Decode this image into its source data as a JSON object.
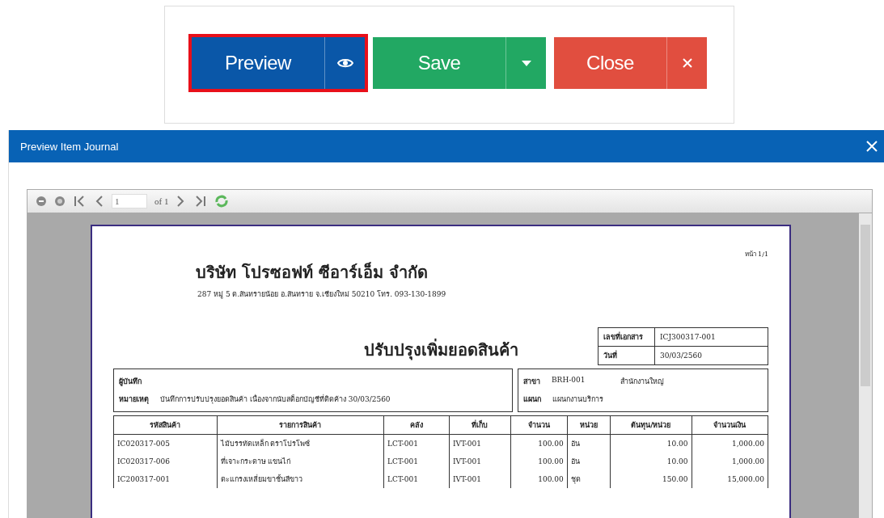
{
  "actions": [
    {
      "kind": "preview",
      "label": "Preview",
      "highlighted": true
    },
    {
      "kind": "save",
      "label": "Save",
      "highlighted": false
    },
    {
      "kind": "close",
      "label": "Close",
      "highlighted": false
    }
  ],
  "dialog": {
    "title": "Preview Item Journal",
    "pager": {
      "page": "1",
      "of": "of 1"
    }
  },
  "report": {
    "page_no": "หน้า 1/1",
    "company": "บริษัท โปรซอฟท์ ซีอาร์เอ็ม จำกัด",
    "address": "287 หมู่ 5 ต.สันทรายน้อย อ.สันทราย จ.เชียงใหม่ 50210 โทร. 093-130-1899",
    "title": "ปรับปรุงเพิ่มยอดสินค้า",
    "doc_fields": [
      {
        "label": "เลขที่เอกสาร",
        "value": "ICJ300317-001"
      },
      {
        "label": "วันที่",
        "value": "30/03/2560"
      }
    ],
    "recorder_label": "ผู้บันทึก",
    "note_label": "หมายเหตุ",
    "note": "บันทึกการปรับปรุงยอดสินค้า เนื่องจากนับสต็อกบัญชีที่ติดค้าง 30/03/2560",
    "branch_label": "สาขา",
    "branch_code": "BRH-001",
    "branch_name": "สำนักงานใหญ่",
    "dept_label": "แผนก",
    "dept": "แผนกงานบริการ",
    "columns": [
      "รหัสสินค้า",
      "รายการสินค้า",
      "คลัง",
      "ที่เก็บ",
      "จำนวน",
      "หน่วย",
      "ต้นทุน/หน่วย",
      "จำนวนเงิน"
    ],
    "rows": [
      [
        "IC020317-005",
        "ไม้บรรทัดเหล็ก ตราโปรโพซ์",
        "LCT-001",
        "IVT-001",
        "100.00",
        "อัน",
        "10.00",
        "1,000.00"
      ],
      [
        "IC020317-006",
        "ที่เจาะกระดาษ แขนไก่",
        "LCT-001",
        "IVT-001",
        "100.00",
        "อัน",
        "10.00",
        "1,000.00"
      ],
      [
        "IC200317-001",
        "ตะแกรงเหลี่ยมขาชั้นสีขาว",
        "LCT-001",
        "IVT-001",
        "100.00",
        "ชุด",
        "150.00",
        "15,000.00"
      ]
    ]
  }
}
